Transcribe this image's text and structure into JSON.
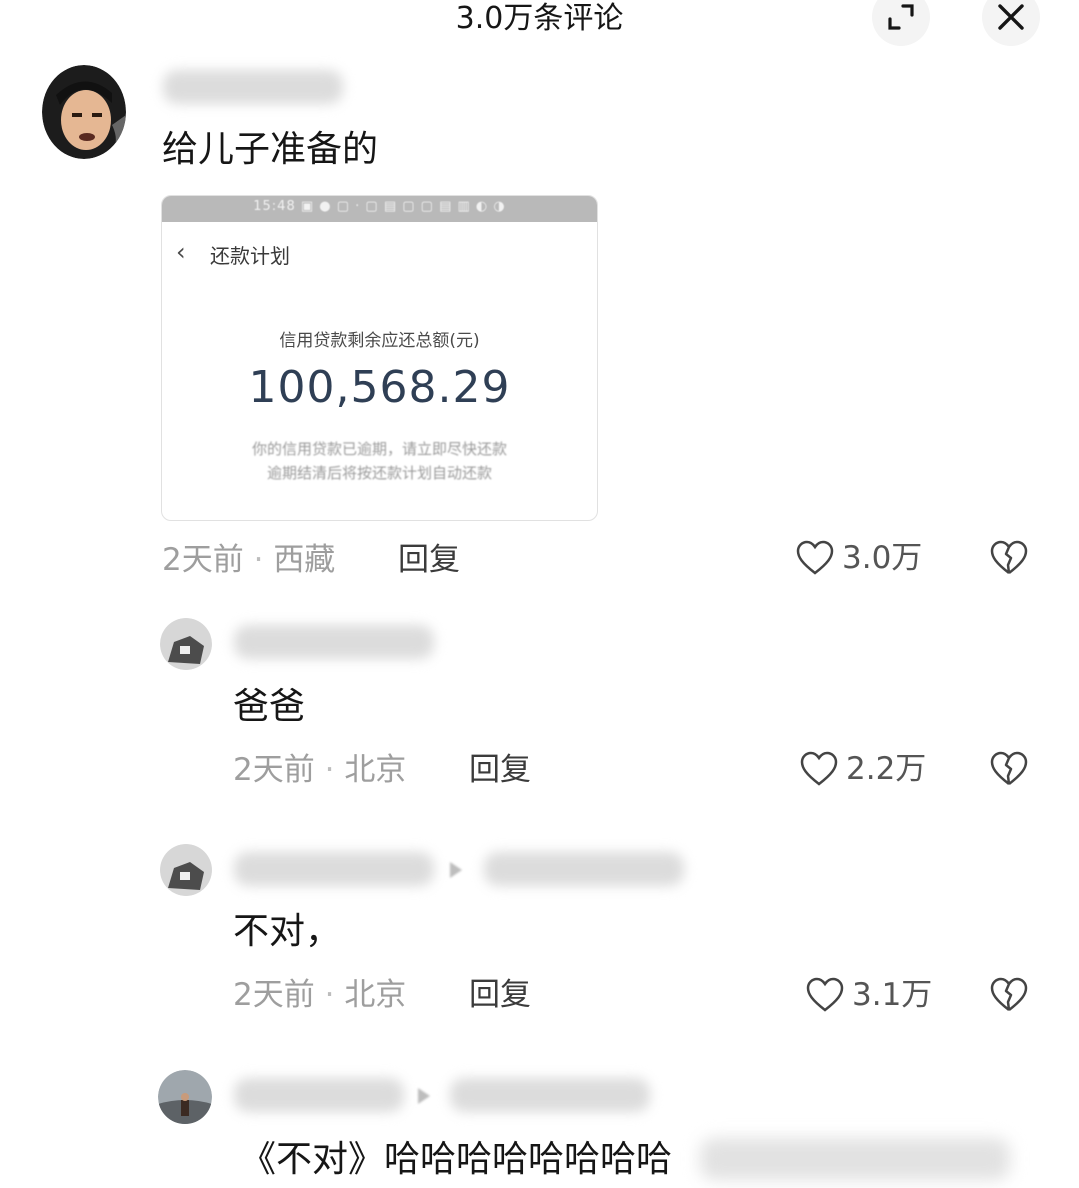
{
  "header": {
    "title": "3.0万条评论"
  },
  "comments": [
    {
      "text": "给儿子准备的",
      "image": {
        "status_text": "15:48 ▣ ● ▢ · ▢ ▤ ▢ ▢ ▤ ▥ ◐ ◑",
        "nav_title": "还款计划",
        "label": "信用贷款剩余应还总额(元)",
        "amount": "100,568.29",
        "note_line1": "你的信用贷款已逾期，请立即尽快还款",
        "note_line2": "逾期结清后将按还款计划自动还款"
      },
      "time": "2天前",
      "location": "西藏",
      "reply_label": "回复",
      "likes": "3.0万"
    },
    {
      "text": "爸爸",
      "time": "2天前",
      "location": "北京",
      "reply_label": "回复",
      "likes": "2.2万"
    },
    {
      "text": "不对，",
      "time": "2天前",
      "location": "北京",
      "reply_label": "回复",
      "likes": "3.1万"
    },
    {
      "text": "《不对》哈哈哈哈哈哈哈哈"
    }
  ],
  "separator": "·",
  "colors": {
    "text": "#161616",
    "meta": "#9e9e9e",
    "amount": "#2f3f55"
  }
}
